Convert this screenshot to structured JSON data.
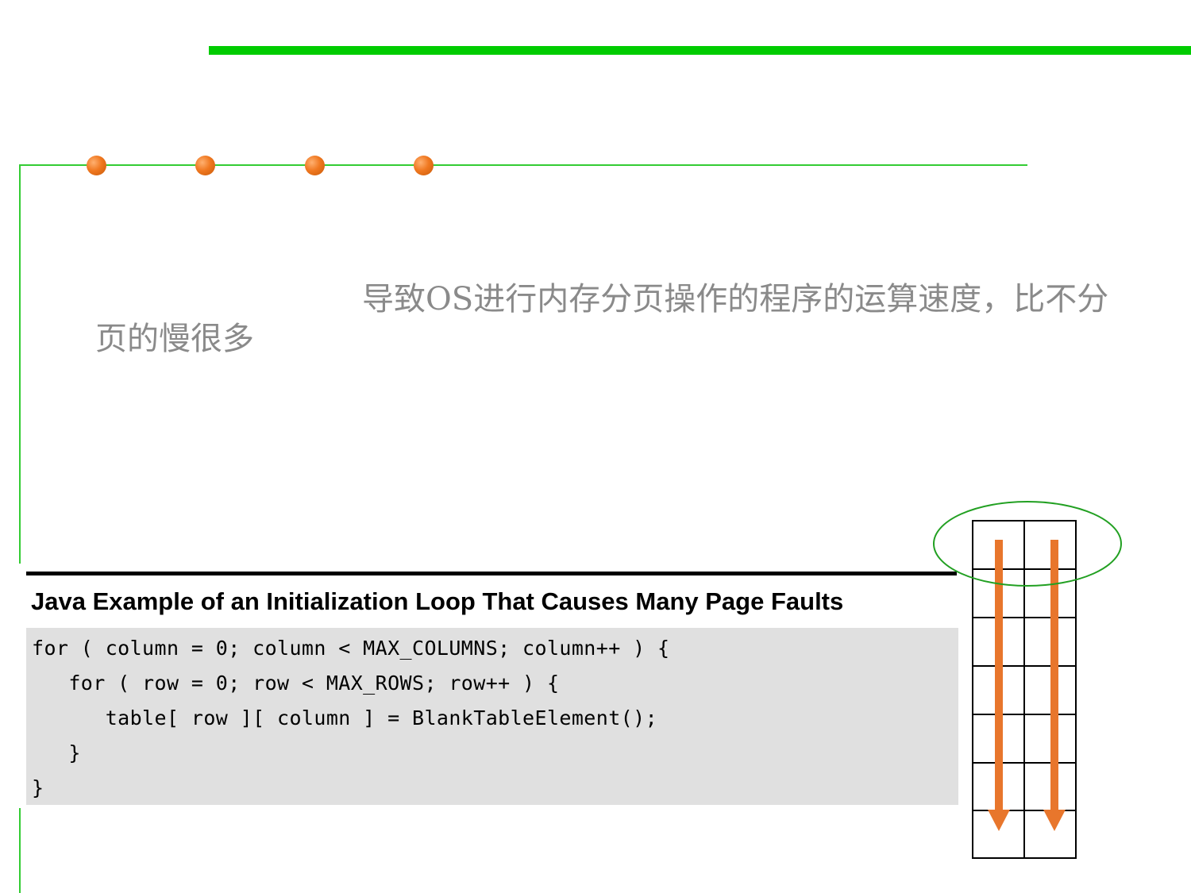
{
  "note": {
    "text": "导致OS进行内存分页操作的程序的运算速度，比不分页的慢很多"
  },
  "example": {
    "heading": "Java Example of an Initialization Loop That Causes Many Page Faults",
    "code_lines": [
      "for ( column = 0; column < MAX_COLUMNS; column++ ) {",
      "   for ( row = 0; row < MAX_ROWS; row++ ) {",
      "      table[ row ][ column ] = BlankTableElement();",
      "   }",
      "}"
    ]
  },
  "diagram": {
    "grid_columns": 2,
    "grid_rows": 7,
    "arrow_direction": "down",
    "arrow_color": "#e8762c",
    "highlight_color": "#22a022"
  },
  "colors": {
    "top_bar": "#00cc00",
    "frame": "#33cc33",
    "bullet": "#f07820",
    "note_text": "#8a8a8a",
    "code_background": "#e0e0e0"
  }
}
